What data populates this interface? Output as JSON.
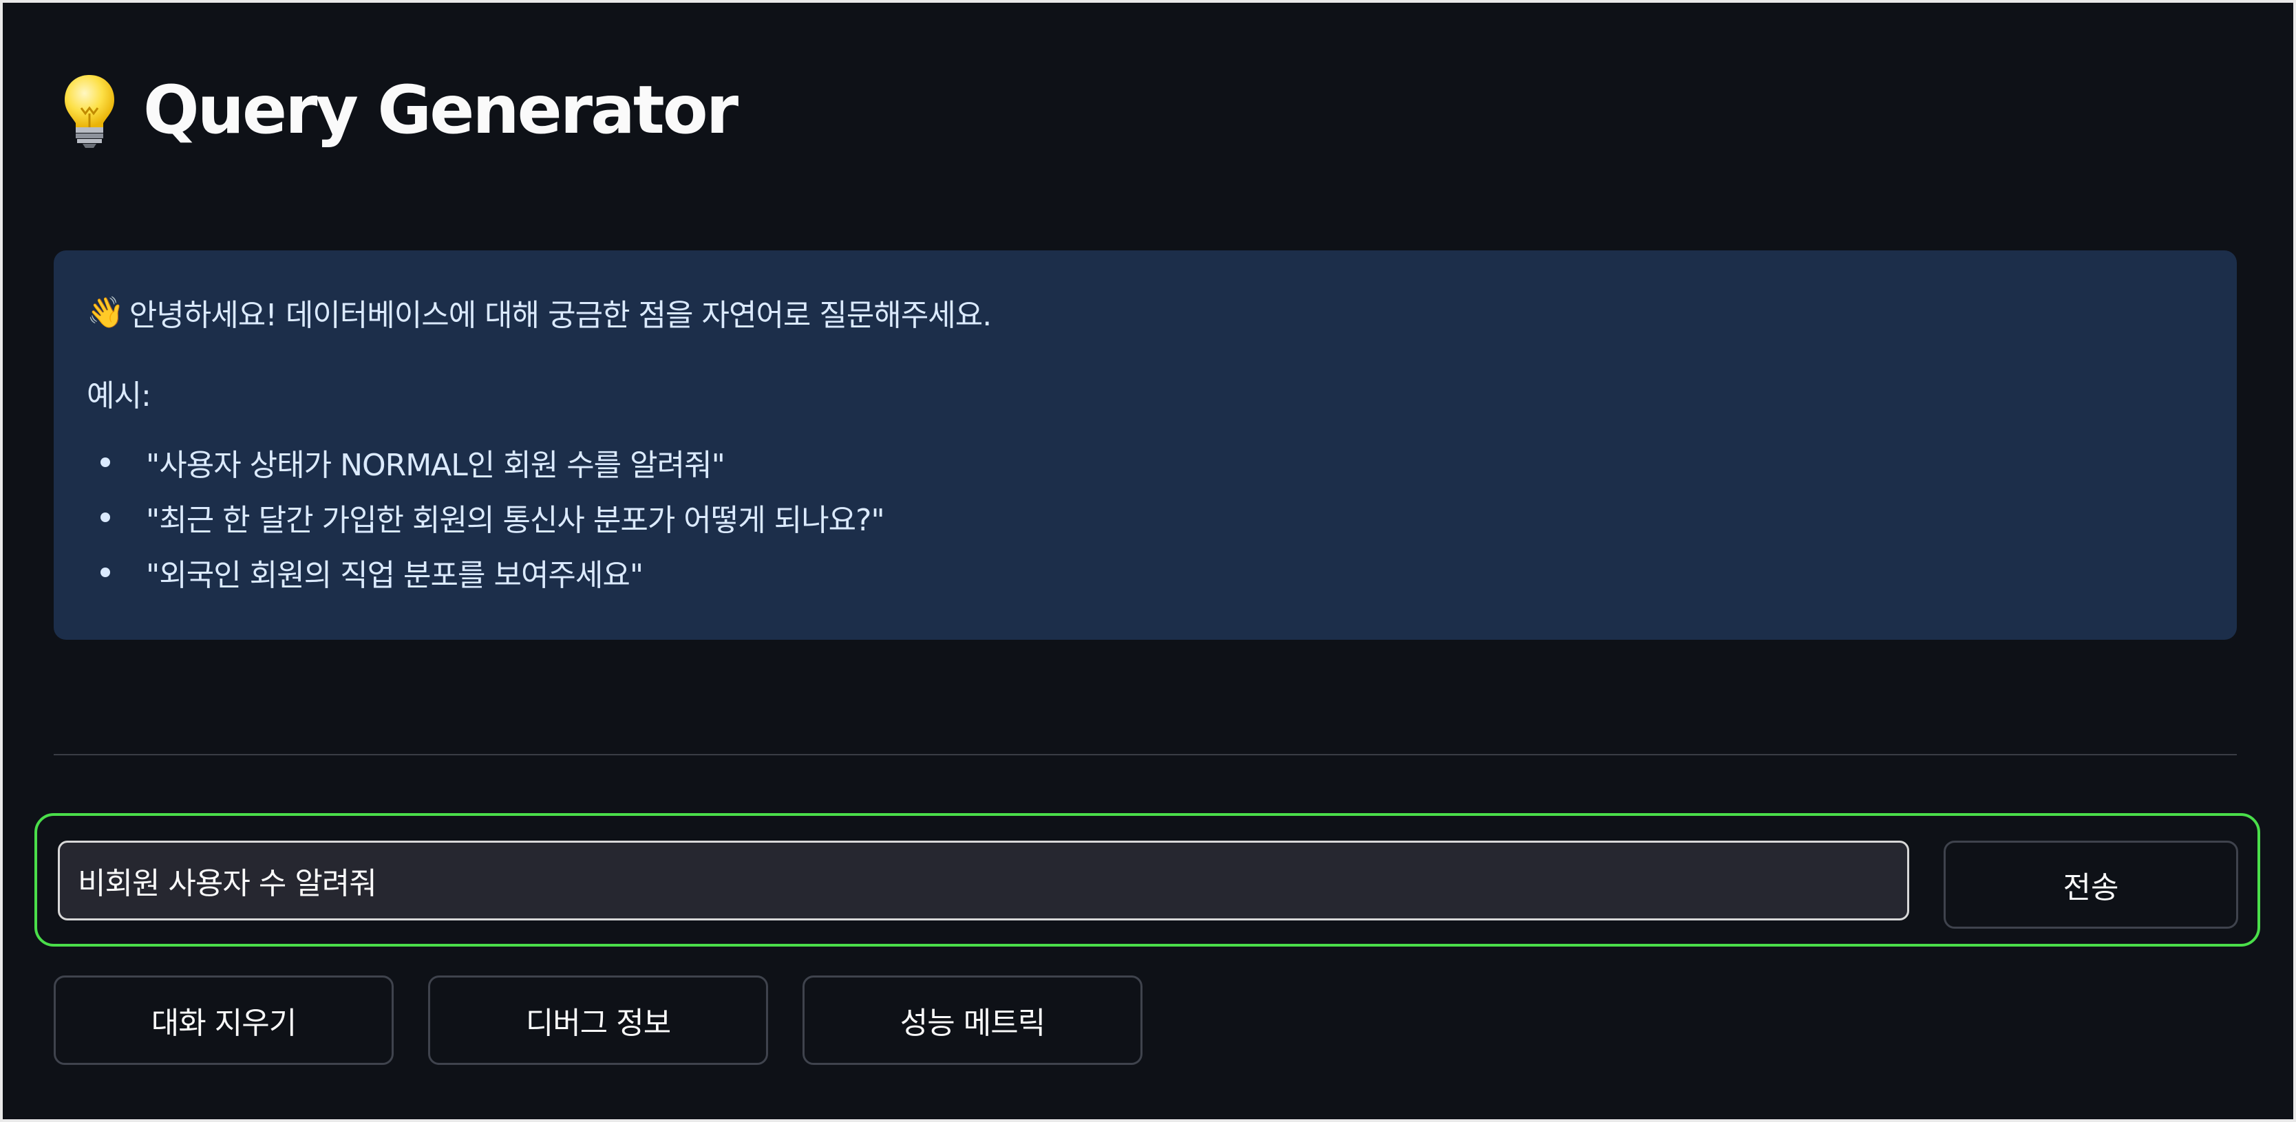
{
  "app": {
    "title": "Query Generator",
    "title_icon": "lightbulb-icon"
  },
  "info": {
    "greeting_icon": "👋",
    "greeting": "안녕하세요! 데이터베이스에 대해 궁금한 점을 자연어로 질문해주세요.",
    "examples_label": "예시:",
    "examples": [
      "\"사용자 상태가 NORMAL인 회원 수를 알려줘\"",
      "\"최근 한 달간 가입한 회원의 통신사 분포가 어떻게 되나요?\"",
      "\"외국인 회원의 직업 분포를 보여주세요\""
    ],
    "background_color": "#1c2e4a"
  },
  "form": {
    "query_value": "비회원 사용자 수 알려줘",
    "send_label": "전송",
    "focus_color": "#4ade4a"
  },
  "actions": {
    "clear_label": "대화 지우기",
    "debug_label": "디버그 정보",
    "metrics_label": "성능 메트릭"
  }
}
